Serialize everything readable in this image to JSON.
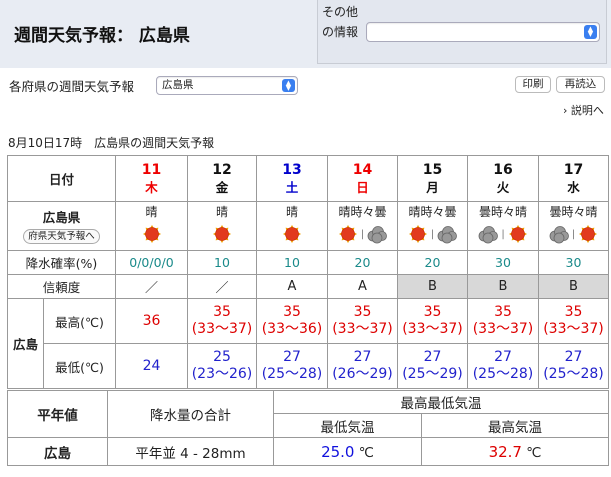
{
  "header": {
    "title": "週間天気予報： 広島県",
    "other_info_label": "その他の情報",
    "other_info_value": ""
  },
  "controls": {
    "region_label": "各府県の週間天気予報",
    "region_value": "広島県",
    "print_label": "印刷",
    "reload_label": "再読込",
    "explain_label": "› 説明へ"
  },
  "forecast": {
    "issued": "8月10日17時　広島県の週間天気予報",
    "date_header": "日付",
    "area_name": "広島県",
    "area_button": "府県天気予報へ",
    "pop_label": "降水確率(%)",
    "reliability_label": "信頼度",
    "city": "広島",
    "max_label": "最高(℃)",
    "min_label": "最低(℃)",
    "days": [
      {
        "num": "11",
        "wd": "木",
        "color": "red",
        "weather": "晴",
        "icons": [
          "sun"
        ],
        "pop": "0/0/0/0",
        "rel": "／",
        "max": "36",
        "max_range": "",
        "min": "24",
        "min_range": ""
      },
      {
        "num": "12",
        "wd": "金",
        "color": "blk",
        "weather": "晴",
        "icons": [
          "sun"
        ],
        "pop": "10",
        "rel": "／",
        "max": "35",
        "max_range": "(33～37)",
        "min": "25",
        "min_range": "(23～26)"
      },
      {
        "num": "13",
        "wd": "土",
        "color": "blue",
        "weather": "晴",
        "icons": [
          "sun"
        ],
        "pop": "10",
        "rel": "A",
        "max": "35",
        "max_range": "(33～36)",
        "min": "27",
        "min_range": "(25～28)"
      },
      {
        "num": "14",
        "wd": "日",
        "color": "red",
        "weather": "晴時々曇",
        "icons": [
          "sun",
          "cloud"
        ],
        "pop": "20",
        "rel": "A",
        "max": "35",
        "max_range": "(33～37)",
        "min": "27",
        "min_range": "(26～29)"
      },
      {
        "num": "15",
        "wd": "月",
        "color": "blk",
        "weather": "晴時々曇",
        "icons": [
          "sun",
          "cloud"
        ],
        "pop": "20",
        "rel": "B",
        "max": "35",
        "max_range": "(33～37)",
        "min": "27",
        "min_range": "(25～29)"
      },
      {
        "num": "16",
        "wd": "火",
        "color": "blk",
        "weather": "曇時々晴",
        "icons": [
          "cloud",
          "sun"
        ],
        "pop": "30",
        "rel": "B",
        "max": "35",
        "max_range": "(33～37)",
        "min": "27",
        "min_range": "(25～28)"
      },
      {
        "num": "17",
        "wd": "水",
        "color": "blk",
        "weather": "曇時々晴",
        "icons": [
          "cloud",
          "sun"
        ],
        "pop": "30",
        "rel": "B",
        "max": "35",
        "max_range": "(33～37)",
        "min": "27",
        "min_range": "(25～28)"
      }
    ]
  },
  "normal": {
    "header": "平年値",
    "precip_label": "降水量の合計",
    "temp_label": "最高最低気温",
    "min_label": "最低気温",
    "max_label": "最高気温",
    "city": "広島",
    "precip_value": "平年並 4 - 28mm",
    "min_value": "25.0",
    "max_value": "32.7",
    "unit": "℃"
  }
}
